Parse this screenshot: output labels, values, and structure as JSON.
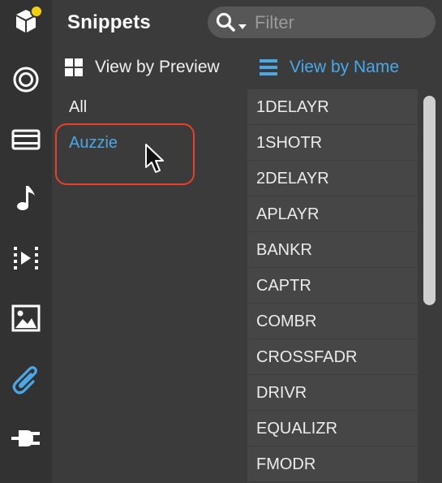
{
  "header": {
    "title": "Snippets"
  },
  "filter": {
    "placeholder": "Filter"
  },
  "view_options": {
    "preview_label": "View by Preview",
    "name_label": "View by Name",
    "active": "name"
  },
  "categories": [
    {
      "label": "All",
      "selected": false
    },
    {
      "label": "Auzzie",
      "selected": true
    }
  ],
  "snippets": [
    "1DELAYR",
    "1SHOTR",
    "2DELAYR",
    "APLAYR",
    "BANKR",
    "CAPTR",
    "COMBR",
    "CROSSFADR",
    "DRIVR",
    "EQUALIZR",
    "FMODR"
  ],
  "colors": {
    "accent": "#4aa8e8",
    "highlight_ring": "#e8402a",
    "badge": "#f5d00a"
  },
  "rail_icons": [
    "cube-icon",
    "target-icon",
    "film-icon",
    "music-note-icon",
    "video-icon",
    "image-icon",
    "paperclip-icon",
    "plug-icon"
  ],
  "rail_active": "paperclip-icon"
}
